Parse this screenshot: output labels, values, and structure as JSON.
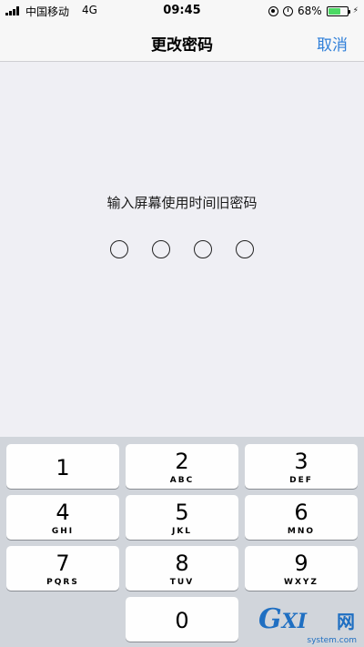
{
  "status_bar": {
    "carrier": "中国移动",
    "network": "4G",
    "time": "09:45",
    "battery_percent": "68%",
    "battery_level": 0.68,
    "icons": [
      "signal-icon",
      "orientation-lock-icon",
      "alarm-icon",
      "battery-icon",
      "charging-icon"
    ]
  },
  "nav": {
    "title": "更改密码",
    "cancel_label": "取消"
  },
  "prompt": "输入屏幕使用时间旧密码",
  "passcode": {
    "length": 4,
    "entered": 0
  },
  "keypad": {
    "keys": [
      {
        "num": "1",
        "letters": ""
      },
      {
        "num": "2",
        "letters": "ABC"
      },
      {
        "num": "3",
        "letters": "DEF"
      },
      {
        "num": "4",
        "letters": "GHI"
      },
      {
        "num": "5",
        "letters": "JKL"
      },
      {
        "num": "6",
        "letters": "MNO"
      },
      {
        "num": "7",
        "letters": "PQRS"
      },
      {
        "num": "8",
        "letters": "TUV"
      },
      {
        "num": "9",
        "letters": "WXYZ"
      },
      {
        "num": "0",
        "letters": ""
      }
    ]
  },
  "watermark": {
    "logo": "GXI",
    "chinese": "网",
    "url": "system.com"
  },
  "colors": {
    "accent": "#2f7fd9",
    "background": "#efeff4",
    "keypad_bg": "#d1d5db",
    "battery_fill": "#4cd964"
  }
}
